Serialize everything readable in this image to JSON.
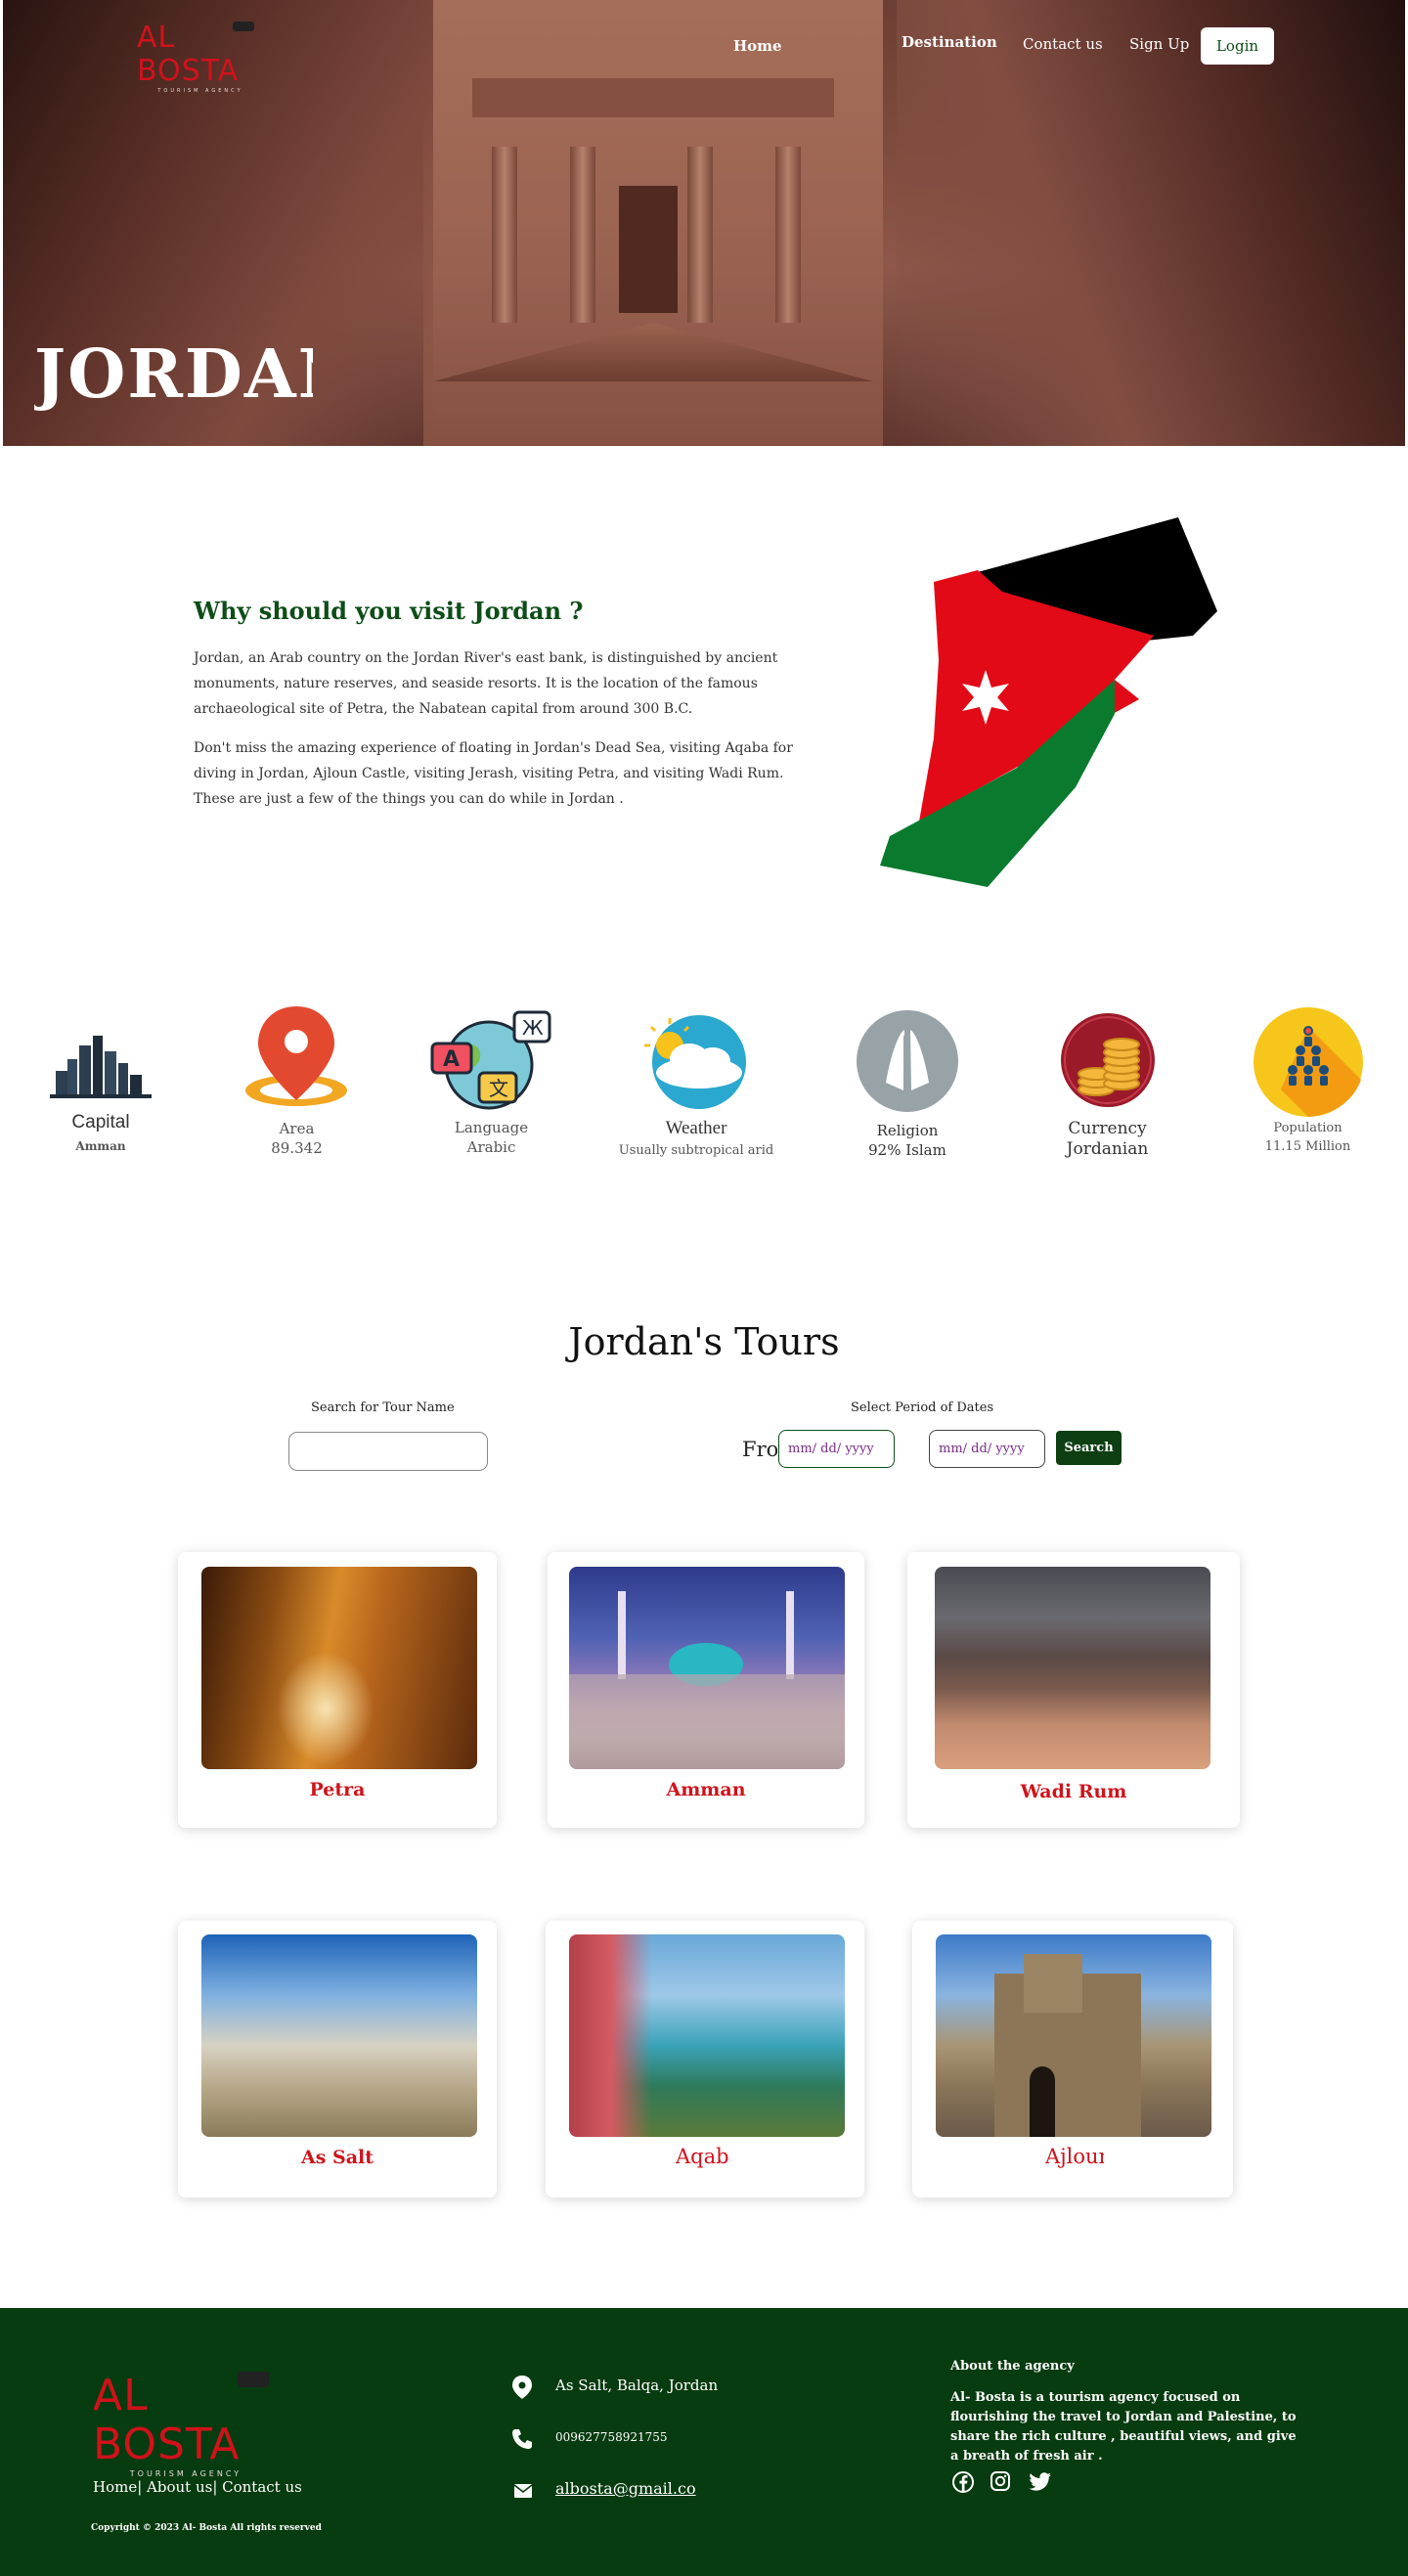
{
  "brand": {
    "logo_word": "AL BOSTA",
    "logo_sub": "TOURISM AGENCY"
  },
  "nav": {
    "home": "Home",
    "destination": "Destination",
    "contact": "Contact us",
    "signup": "Sign Up",
    "login": "Login"
  },
  "hero": {
    "title": "JORDAN"
  },
  "intro": {
    "title": "Why should you visit Jordan ?",
    "p1": "Jordan, an Arab country on the Jordan River's east bank, is distinguished by ancient monuments, nature reserves, and seaside resorts. It is the location of the famous archaeological site of Petra, the Nabatean capital from around 300 B.C.",
    "p2": "Don't miss the amazing experience of floating in Jordan's Dead Sea, visiting Aqaba for diving in Jordan, Ajloun Castle, visiting Jerash, visiting Petra, and visiting Wadi Rum. These are just a few of the things you can do while in Jordan ."
  },
  "stats": {
    "capital": {
      "label": "Capital",
      "value": "Amman"
    },
    "area": {
      "label": "Area",
      "value": "89.342"
    },
    "language": {
      "label": "Language",
      "value": "Arabic"
    },
    "weather": {
      "label": "Weather",
      "value": "Usually subtropical arid"
    },
    "religion": {
      "label": "Religion",
      "value": "92% Islam"
    },
    "currency": {
      "label": "Currency",
      "value": "Jordanian"
    },
    "population": {
      "label": "Population",
      "value": "11.15 Million"
    }
  },
  "tours": {
    "title": "Jordan's Tours",
    "search_name_label": "Search for Tour Name",
    "search_name_value": "",
    "period_label": "Select Period of Dates",
    "from_label": "From",
    "from_placeholder": "mm/ dd/ yyyy",
    "to_placeholder": "mm/ dd/ yyyy",
    "search_button": "Search",
    "cards": [
      {
        "name": "Petra"
      },
      {
        "name": "Amman"
      },
      {
        "name": "Wadi Rum"
      },
      {
        "name": "As Salt"
      },
      {
        "name": "Aqaba"
      },
      {
        "name": "Ajloun"
      }
    ]
  },
  "footer": {
    "links": "Home| About us| Contact us",
    "copyright": "Copyright © 2023 Al- Bosta All rights reserved",
    "address": "As Salt, Balqa, Jordan",
    "phone": "009627758921755",
    "email": "albosta@gmail.co",
    "about_title": "About the agency",
    "about_text": "Al- Bosta is a tourism agency focused on flourishing the travel to Jordan and Palestine, to share the rich culture , beautiful views, and give a breath of fresh air ."
  },
  "colors": {
    "brand_red": "#d0121b",
    "brand_green": "#073b10",
    "title_green": "#0d4d18"
  },
  "icons": [
    "skyline-icon",
    "map-pin-icon",
    "language-globe-icon",
    "weather-icon",
    "praying-hands-icon",
    "coins-icon",
    "population-icon",
    "location-icon",
    "phone-icon",
    "mail-icon",
    "facebook-icon",
    "instagram-icon",
    "twitter-icon"
  ]
}
